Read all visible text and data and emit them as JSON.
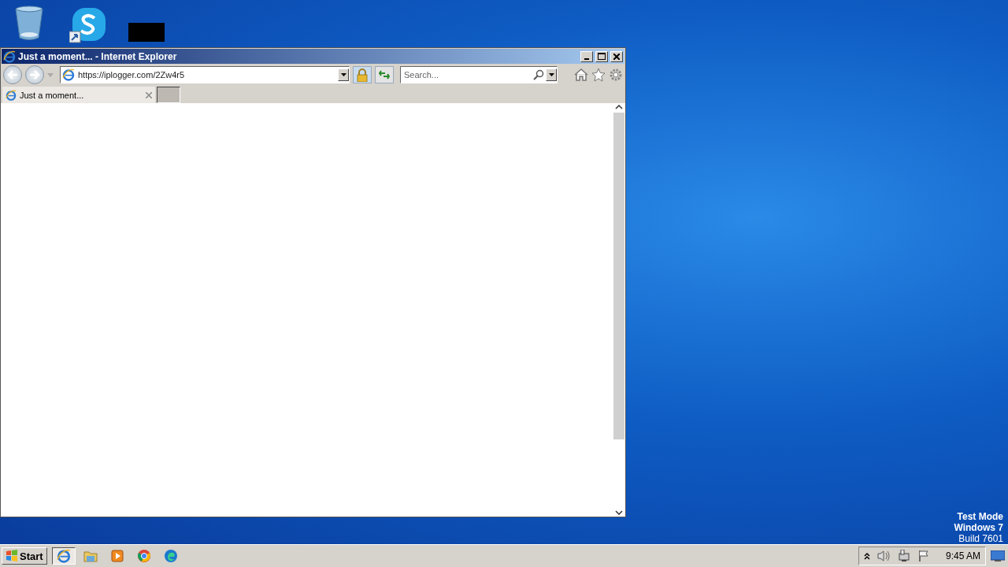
{
  "window": {
    "title": "Just a moment... - Internet Explorer",
    "address": "https://iplogger.com/2Zw4r5",
    "search": {
      "placeholder": "Search..."
    },
    "tabs": [
      {
        "label": "Just a moment...",
        "selected": true
      }
    ]
  },
  "desktop_notice": [
    "Test Mode",
    "Windows 7",
    "Build 7601"
  ],
  "taskbar": {
    "start": "Start",
    "apps": [
      {
        "kind": "ie",
        "selected": true
      },
      {
        "kind": "folder",
        "selected": false
      },
      {
        "kind": "media",
        "selected": false
      },
      {
        "kind": "chrome",
        "selected": false
      },
      {
        "kind": "edge",
        "selected": false
      }
    ],
    "clock": "9:45 AM"
  }
}
